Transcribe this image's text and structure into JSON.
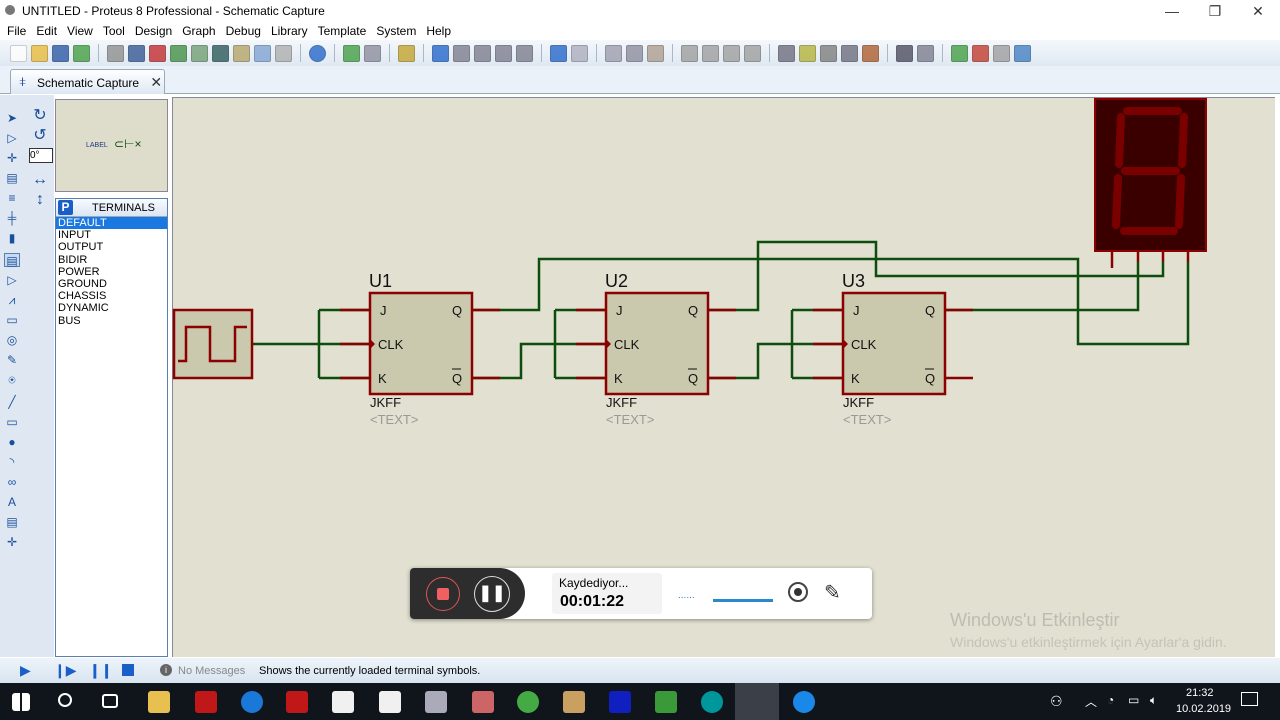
{
  "window": {
    "title": "UNTITLED - Proteus 8 Professional - Schematic Capture",
    "minimize": "—",
    "maximize": "❐",
    "close": "✕"
  },
  "menu": [
    "File",
    "Edit",
    "View",
    "Tool",
    "Design",
    "Graph",
    "Debug",
    "Library",
    "Template",
    "System",
    "Help"
  ],
  "toolbar_icons": [
    "new-icon",
    "open-icon",
    "save-icon",
    "import-icon",
    "home-icon",
    "schematic-icon",
    "pcb-icon",
    "gerber-icon",
    "3d-icon",
    "bom-icon",
    "cost-icon",
    "source-icon",
    "notes-icon",
    "help-icon",
    "refresh-icon",
    "grid-icon",
    "origin-icon",
    "pan-icon",
    "zoom-in-icon",
    "zoom-out-icon",
    "zoom-all-icon",
    "zoom-area-icon",
    "undo-icon",
    "redo-icon",
    "cut-icon",
    "copy-icon",
    "paste-icon",
    "block-copy-icon",
    "block-move-icon",
    "block-rotate-icon",
    "block-delete-icon",
    "pick-device-icon",
    "make-device-icon",
    "package-icon",
    "decompose-icon",
    "wire-autorouter-icon",
    "search-icon",
    "property-icon",
    "new-sheet-icon",
    "remove-sheet-icon",
    "child-sheet-icon",
    "report-icon"
  ],
  "tab": {
    "label": "Schematic Capture",
    "close": "✕"
  },
  "rotation": {
    "value": "0°"
  },
  "preview": {
    "label": "LABEL"
  },
  "terminals": {
    "badge": "P",
    "title": "TERMINALS",
    "items": [
      "DEFAULT",
      "INPUT",
      "OUTPUT",
      "BIDIR",
      "POWER",
      "GROUND",
      "CHASSIS",
      "DYNAMIC",
      "BUS"
    ],
    "selected": "DEFAULT"
  },
  "schematic": {
    "parts": [
      {
        "ref": "U1",
        "type": "JKFF",
        "text": "<TEXT>"
      },
      {
        "ref": "U2",
        "type": "JKFF",
        "text": "<TEXT>"
      },
      {
        "ref": "U3",
        "type": "JKFF",
        "text": "<TEXT>"
      }
    ],
    "pins": {
      "j": "J",
      "clk": "CLK",
      "k": "K",
      "q": "Q",
      "qbar": "Q"
    },
    "colors": {
      "wire": "#0d4d0d",
      "pin": "#8b0000",
      "body": "#cac8ad",
      "display_bg": "#3a0000",
      "segment": "#7a0000",
      "canvas": "#e1e0d1"
    }
  },
  "status": {
    "messages": "No Messages",
    "hint": "Shows the currently loaded terminal symbols."
  },
  "recorder": {
    "status": "Kaydediyor...",
    "time": "00:01:22",
    "dots": "......"
  },
  "watermark": {
    "title": "Windows'u Etkinleştir",
    "subtitle": "Windows'u etkinleştirmek için Ayarlar'a gidin."
  },
  "clock": {
    "time": "21:32",
    "date": "10.02.2019"
  }
}
